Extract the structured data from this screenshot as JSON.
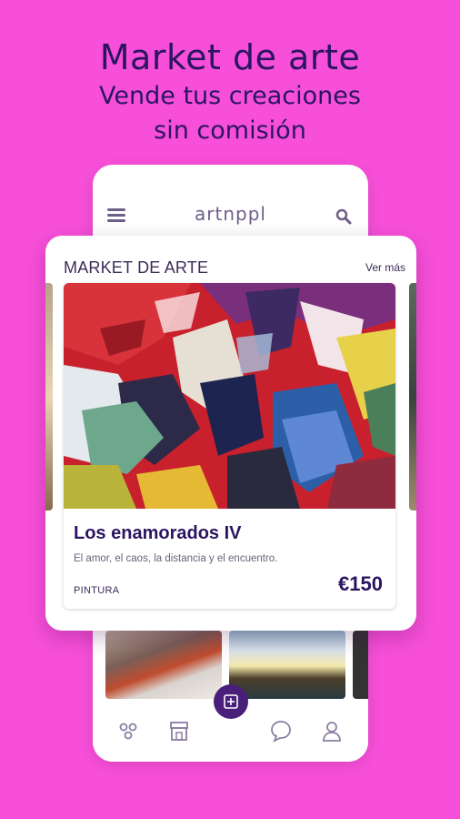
{
  "headline": {
    "title": "Market de arte",
    "subtitle_line1": "Vende tus creaciones",
    "subtitle_line2": "sin comisión"
  },
  "app": {
    "brand": "artnppl",
    "header_icons": [
      "menu-icon",
      "search-icon"
    ]
  },
  "market": {
    "section_title": "MARKET DE ARTE",
    "see_more": "Ver más",
    "featured": {
      "title": "Los enamorados IV",
      "description": "El amor, el caos, la distancia y el encuentro.",
      "category": "PINTURA",
      "price": "€150"
    }
  },
  "bottom_nav": {
    "items": [
      "home-icon",
      "shop-icon",
      "add-icon",
      "chat-icon",
      "profile-icon"
    ]
  },
  "colors": {
    "background": "#f74fd9",
    "primary": "#2b1560",
    "fab": "#4a1f7a"
  }
}
